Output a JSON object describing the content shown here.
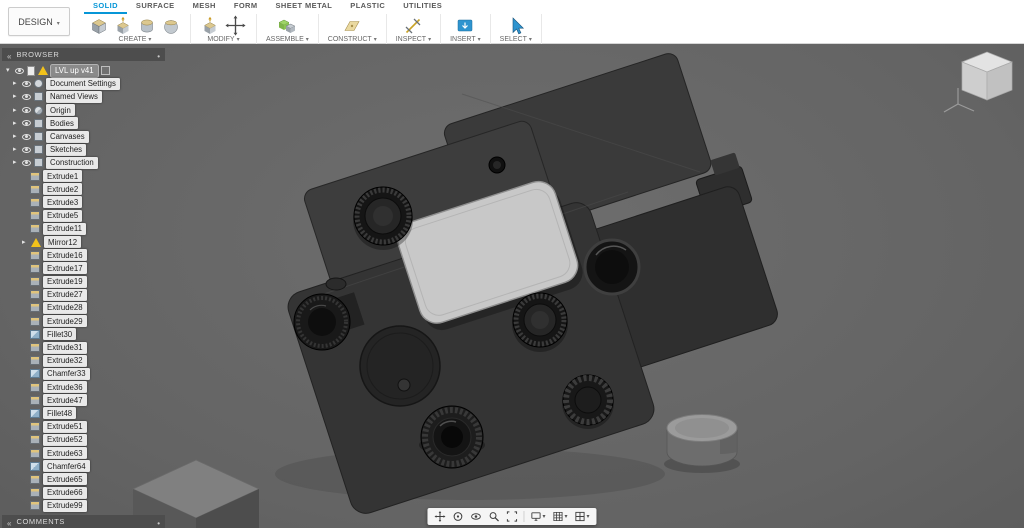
{
  "colors": {
    "accent": "#0696d7",
    "canvas_bg": "#676767",
    "toolbar_bg": "#ffffff"
  },
  "toolbar": {
    "design_label": "DESIGN",
    "tabs": [
      {
        "label": "SOLID",
        "active": true
      },
      {
        "label": "SURFACE",
        "active": false
      },
      {
        "label": "MESH",
        "active": false
      },
      {
        "label": "FORM",
        "active": false
      },
      {
        "label": "SHEET METAL",
        "active": false
      },
      {
        "label": "PLASTIC",
        "active": false
      },
      {
        "label": "UTILITIES",
        "active": false
      }
    ],
    "groups": [
      {
        "label": "CREATE"
      },
      {
        "label": "MODIFY"
      },
      {
        "label": "ASSEMBLE"
      },
      {
        "label": "CONSTRUCT"
      },
      {
        "label": "INSPECT"
      },
      {
        "label": "INSERT"
      },
      {
        "label": "SELECT"
      }
    ]
  },
  "browser": {
    "title": "BROWSER",
    "root_label": "LVL up v41",
    "folders": [
      {
        "label": "Document Settings",
        "icon": "gear-icon"
      },
      {
        "label": "Named Views",
        "icon": "views-icon"
      },
      {
        "label": "Origin",
        "icon": "origin-icon"
      },
      {
        "label": "Bodies",
        "icon": "bodies-icon"
      },
      {
        "label": "Canvases",
        "icon": "canvases-icon"
      },
      {
        "label": "Sketches",
        "icon": "sketches-icon"
      },
      {
        "label": "Construction",
        "icon": "construction-icon"
      }
    ],
    "features": [
      {
        "label": "Extrude1",
        "icon": "extrude-icon"
      },
      {
        "label": "Extrude2",
        "icon": "extrude-icon"
      },
      {
        "label": "Extrude3",
        "icon": "extrude-icon"
      },
      {
        "label": "Extrude5",
        "icon": "extrude-icon"
      },
      {
        "label": "Extrude11",
        "icon": "extrude-icon"
      },
      {
        "label": "Mirror12",
        "icon": "warning-icon",
        "expandable": true
      },
      {
        "label": "Extrude16",
        "icon": "extrude-icon"
      },
      {
        "label": "Extrude17",
        "icon": "extrude-icon"
      },
      {
        "label": "Extrude19",
        "icon": "extrude-icon"
      },
      {
        "label": "Extrude27",
        "icon": "extrude-icon"
      },
      {
        "label": "Extrude28",
        "icon": "extrude-icon"
      },
      {
        "label": "Extrude29",
        "icon": "extrude-icon"
      },
      {
        "label": "Fillet30",
        "icon": "fillet-icon"
      },
      {
        "label": "Extrude31",
        "icon": "extrude-icon"
      },
      {
        "label": "Extrude32",
        "icon": "extrude-icon"
      },
      {
        "label": "Chamfer33",
        "icon": "chamfer-icon"
      },
      {
        "label": "Extrude36",
        "icon": "extrude-icon"
      },
      {
        "label": "Extrude47",
        "icon": "extrude-icon"
      },
      {
        "label": "Fillet48",
        "icon": "fillet-icon"
      },
      {
        "label": "Extrude51",
        "icon": "extrude-icon"
      },
      {
        "label": "Extrude52",
        "icon": "extrude-icon"
      },
      {
        "label": "Extrude63",
        "icon": "extrude-icon"
      },
      {
        "label": "Chamfer64",
        "icon": "chamfer-icon"
      },
      {
        "label": "Extrude65",
        "icon": "extrude-icon"
      },
      {
        "label": "Extrude66",
        "icon": "extrude-icon"
      },
      {
        "label": "Extrude99",
        "icon": "extrude-icon"
      }
    ]
  },
  "comments": {
    "title": "COMMENTS"
  },
  "navbar": {
    "buttons": [
      {
        "name": "pan"
      },
      {
        "name": "orbit"
      },
      {
        "name": "look-at"
      },
      {
        "name": "zoom"
      },
      {
        "name": "fit"
      },
      {
        "name": "display-settings",
        "has_menu": true
      },
      {
        "name": "grid-and-snaps",
        "has_menu": true
      },
      {
        "name": "viewports",
        "has_menu": true
      }
    ]
  }
}
